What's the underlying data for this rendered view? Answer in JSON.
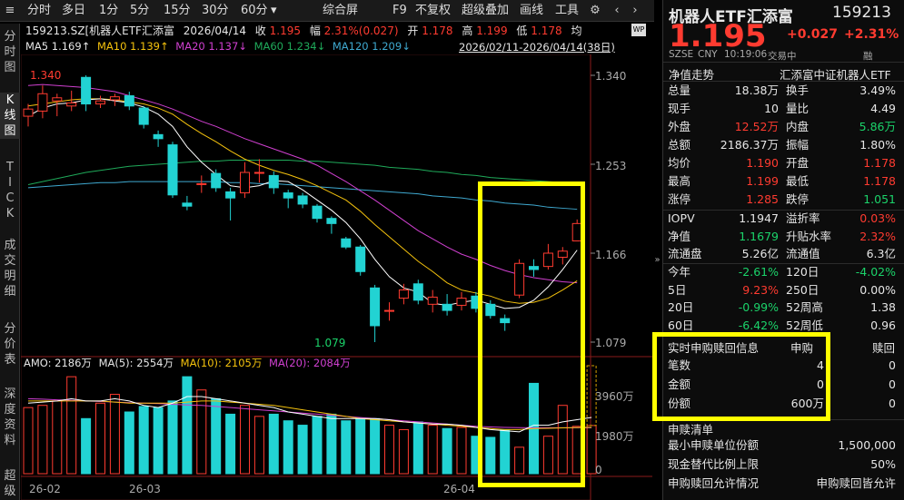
{
  "toolbar": {
    "items": [
      "分时",
      "多日",
      "1分",
      "5分",
      "15分",
      "30分",
      "60分"
    ],
    "more_label": "▾",
    "right_items": [
      "综合屏",
      "F9",
      "不复权",
      "超级叠加",
      "画线",
      "工具"
    ]
  },
  "leftnav": [
    {
      "label": "分\n时\n图",
      "active": false
    },
    {
      "label": "K\n线\n图",
      "active": true
    },
    {
      "label": "T\nI\nC\nK",
      "active": false
    },
    {
      "label": "成\n交\n明\n细",
      "active": false
    },
    {
      "label": "分\n价\n表",
      "active": false
    },
    {
      "label": "深\n度\n资\n料",
      "active": false
    },
    {
      "label": "超\n级",
      "active": false
    }
  ],
  "info_line": {
    "code_name": "159213.SZ[机器人ETF汇添富",
    "date": "2026/04/14",
    "close_label": "收",
    "close": "1.195",
    "chg_label": "幅",
    "chg": "2.31%(0.027)",
    "open_label": "开",
    "open": "1.178",
    "high_label": "高",
    "high": "1.199",
    "low_label": "低",
    "low": "1.178",
    "avg_label": "均"
  },
  "ma_line": {
    "ma5": "MA5 1.169↑",
    "ma10": "MA10 1.139↑",
    "ma20": "MA20 1.137↓",
    "ma60": "MA60 1.234↓",
    "ma120": "MA120 1.209↓",
    "range": "2026/02/11-2026/04/14(38日)"
  },
  "price_axis": [
    "1.340",
    "1.253",
    "1.166",
    "1.079"
  ],
  "vol_axis": [
    "3960万",
    "1980万",
    "0"
  ],
  "date_axis": [
    "26-02",
    "26-03",
    "26-04"
  ],
  "annotations": {
    "high_mark": "1.340",
    "low_mark": "1.079"
  },
  "volume_line": {
    "amo": "AMO: 2186万",
    "ma5": "MA(5): 2554万",
    "ma10": "MA(10): 2105万",
    "ma20": "MA(20): 2084万"
  },
  "colors": {
    "up": "#ff3b30",
    "down": "#22d3d3",
    "ma5": "#ffffff",
    "ma10": "#f4c20d",
    "ma20": "#d040d0",
    "ma60": "#1faa5a",
    "ma120": "#3fa9d0",
    "highlight_box": "#ffff00"
  },
  "chart_data": {
    "type": "candlestick",
    "ylim": [
      1.079,
      1.34
    ],
    "candles": [
      {
        "o": 1.3,
        "c": 1.307,
        "h": 1.312,
        "l": 1.29
      },
      {
        "o": 1.305,
        "c": 1.322,
        "h": 1.33,
        "l": 1.298
      },
      {
        "o": 1.315,
        "c": 1.318,
        "h": 1.322,
        "l": 1.3
      },
      {
        "o": 1.31,
        "c": 1.313,
        "h": 1.325,
        "l": 1.305
      },
      {
        "o": 1.338,
        "c": 1.312,
        "h": 1.34,
        "l": 1.305
      },
      {
        "o": 1.312,
        "c": 1.315,
        "h": 1.32,
        "l": 1.308
      },
      {
        "o": 1.316,
        "c": 1.319,
        "h": 1.322,
        "l": 1.31
      },
      {
        "o": 1.32,
        "c": 1.31,
        "h": 1.324,
        "l": 1.306
      },
      {
        "o": 1.308,
        "c": 1.292,
        "h": 1.31,
        "l": 1.288
      },
      {
        "o": 1.282,
        "c": 1.278,
        "h": 1.286,
        "l": 1.27
      },
      {
        "o": 1.272,
        "c": 1.223,
        "h": 1.275,
        "l": 1.22
      },
      {
        "o": 1.215,
        "c": 1.212,
        "h": 1.222,
        "l": 1.208
      },
      {
        "o": 1.234,
        "c": 1.234,
        "h": 1.242,
        "l": 1.225
      },
      {
        "o": 1.244,
        "c": 1.23,
        "h": 1.248,
        "l": 1.226
      },
      {
        "o": 1.226,
        "c": 1.22,
        "h": 1.23,
        "l": 1.198
      },
      {
        "o": 1.225,
        "c": 1.245,
        "h": 1.255,
        "l": 1.22
      },
      {
        "o": 1.245,
        "c": 1.245,
        "h": 1.258,
        "l": 1.235
      },
      {
        "o": 1.242,
        "c": 1.23,
        "h": 1.246,
        "l": 1.224
      },
      {
        "o": 1.225,
        "c": 1.22,
        "h": 1.228,
        "l": 1.21
      },
      {
        "o": 1.222,
        "c": 1.214,
        "h": 1.225,
        "l": 1.21
      },
      {
        "o": 1.212,
        "c": 1.2,
        "h": 1.214,
        "l": 1.196
      },
      {
        "o": 1.2,
        "c": 1.195,
        "h": 1.202,
        "l": 1.185
      },
      {
        "o": 1.18,
        "c": 1.172,
        "h": 1.182,
        "l": 1.17
      },
      {
        "o": 1.172,
        "c": 1.148,
        "h": 1.174,
        "l": 1.144
      },
      {
        "o": 1.132,
        "c": 1.095,
        "h": 1.135,
        "l": 1.079
      },
      {
        "o": 1.11,
        "c": 1.11,
        "h": 1.118,
        "l": 1.1
      },
      {
        "o": 1.122,
        "c": 1.13,
        "h": 1.136,
        "l": 1.116
      },
      {
        "o": 1.136,
        "c": 1.12,
        "h": 1.14,
        "l": 1.116
      },
      {
        "o": 1.116,
        "c": 1.123,
        "h": 1.13,
        "l": 1.108
      },
      {
        "o": 1.116,
        "c": 1.11,
        "h": 1.126,
        "l": 1.105
      },
      {
        "o": 1.115,
        "c": 1.122,
        "h": 1.128,
        "l": 1.11
      },
      {
        "o": 1.124,
        "c": 1.112,
        "h": 1.128,
        "l": 1.108
      },
      {
        "o": 1.116,
        "c": 1.105,
        "h": 1.12,
        "l": 1.102
      },
      {
        "o": 1.102,
        "c": 1.098,
        "h": 1.106,
        "l": 1.09
      },
      {
        "o": 1.125,
        "c": 1.156,
        "h": 1.16,
        "l": 1.122
      },
      {
        "o": 1.153,
        "c": 1.15,
        "h": 1.16,
        "l": 1.143
      },
      {
        "o": 1.153,
        "c": 1.166,
        "h": 1.175,
        "l": 1.15
      },
      {
        "o": 1.162,
        "c": 1.168,
        "h": 1.172,
        "l": 1.155
      },
      {
        "o": 1.178,
        "c": 1.195,
        "h": 1.199,
        "l": 1.178
      }
    ],
    "ma5": [
      1.3,
      1.308,
      1.312,
      1.313,
      1.316,
      1.317,
      1.315,
      1.313,
      1.309,
      1.302,
      1.29,
      1.27,
      1.255,
      1.243,
      1.232,
      1.23,
      1.232,
      1.237,
      1.236,
      1.228,
      1.218,
      1.208,
      1.196,
      1.18,
      1.16,
      1.143,
      1.132,
      1.128,
      1.117,
      1.115,
      1.118,
      1.12,
      1.116,
      1.112,
      1.113,
      1.12,
      1.133,
      1.15,
      1.169
    ],
    "ma10": [
      1.31,
      1.312,
      1.314,
      1.316,
      1.317,
      1.317,
      1.316,
      1.314,
      1.312,
      1.308,
      1.302,
      1.292,
      1.283,
      1.275,
      1.266,
      1.258,
      1.252,
      1.247,
      1.243,
      1.238,
      1.232,
      1.225,
      1.218,
      1.207,
      1.194,
      1.182,
      1.17,
      1.158,
      1.148,
      1.137,
      1.13,
      1.127,
      1.124,
      1.119,
      1.117,
      1.118,
      1.122,
      1.13,
      1.139
    ],
    "ma20": [
      1.33,
      1.331,
      1.33,
      1.329,
      1.328,
      1.326,
      1.324,
      1.32,
      1.316,
      1.312,
      1.307,
      1.301,
      1.295,
      1.29,
      1.284,
      1.278,
      1.273,
      1.268,
      1.263,
      1.258,
      1.252,
      1.244,
      1.236,
      1.227,
      1.218,
      1.208,
      1.198,
      1.188,
      1.18,
      1.172,
      1.165,
      1.16,
      1.154,
      1.149,
      1.145,
      1.142,
      1.14,
      1.138,
      1.137
    ],
    "ma60": [
      1.233,
      1.236,
      1.239,
      1.242,
      1.245,
      1.247,
      1.249,
      1.251,
      1.252,
      1.253,
      1.254,
      1.255,
      1.256,
      1.256,
      1.257,
      1.257,
      1.257,
      1.257,
      1.257,
      1.256,
      1.256,
      1.255,
      1.254,
      1.253,
      1.252,
      1.25,
      1.249,
      1.248,
      1.246,
      1.245,
      1.243,
      1.242,
      1.24,
      1.239,
      1.238,
      1.237,
      1.236,
      1.235,
      1.234
    ],
    "ma120": [
      1.23,
      1.231,
      1.232,
      1.233,
      1.234,
      1.235,
      1.235,
      1.236,
      1.236,
      1.236,
      1.236,
      1.236,
      1.236,
      1.236,
      1.235,
      1.235,
      1.234,
      1.234,
      1.233,
      1.232,
      1.231,
      1.23,
      1.229,
      1.228,
      1.227,
      1.226,
      1.225,
      1.224,
      1.222,
      1.221,
      1.22,
      1.218,
      1.217,
      1.215,
      1.214,
      1.213,
      1.211,
      1.21,
      1.209
    ],
    "volume_unit": "万",
    "volume_ylim": [
      0,
      4900
    ],
    "volumes": [
      3000,
      3100,
      3300,
      4400,
      2500,
      3200,
      3600,
      2800,
      3050,
      3000,
      3300,
      4400,
      3800,
      3400,
      2700,
      3100,
      2600,
      2700,
      2400,
      2200,
      2600,
      2700,
      2400,
      2500,
      2500,
      2200,
      2000,
      2350,
      2200,
      2050,
      2100,
      1700,
      1650,
      2000,
      1200,
      4100,
      1700,
      3100,
      2150,
      2186
    ],
    "volume_ma5": [
      3200,
      3250,
      3300,
      3400,
      3300,
      3300,
      3400,
      3300,
      3100,
      3000,
      3200,
      3500,
      3500,
      3400,
      3300,
      3200,
      3100,
      3000,
      2800,
      2700,
      2600,
      2500,
      2500,
      2500,
      2500,
      2450,
      2350,
      2300,
      2250,
      2250,
      2200,
      2100,
      2000,
      1950,
      1900,
      2200,
      2200,
      2350,
      2450,
      2554
    ],
    "volume_ma10": [
      3300,
      3300,
      3300,
      3300,
      3300,
      3300,
      3250,
      3200,
      3200,
      3200,
      3200,
      3250,
      3300,
      3300,
      3250,
      3200,
      3150,
      3100,
      3000,
      2900,
      2800,
      2700,
      2600,
      2500,
      2450,
      2400,
      2350,
      2300,
      2250,
      2200,
      2150,
      2100,
      2050,
      2000,
      2000,
      2050,
      2060,
      2080,
      2095,
      2105
    ],
    "volume_ma20": [
      3400,
      3380,
      3350,
      3330,
      3300,
      3280,
      3250,
      3220,
      3200,
      3180,
      3150,
      3120,
      3100,
      3050,
      3000,
      2950,
      2900,
      2850,
      2800,
      2750,
      2700,
      2650,
      2600,
      2550,
      2500,
      2450,
      2400,
      2350,
      2300,
      2250,
      2200,
      2150,
      2120,
      2100,
      2090,
      2085,
      2085,
      2084,
      2084,
      2084
    ]
  },
  "quote": {
    "name": "机器人ETF汇添富",
    "code": "159213",
    "price": "1.195",
    "change": "+0.027",
    "change_pct": "+2.31%",
    "exchange": "SZSE",
    "currency": "CNY",
    "time": "10:19:06",
    "status": "交易中",
    "rong": "融",
    "nav_trend_label": "净值走势",
    "fund_full_name": "汇添富中证机器人ETF"
  },
  "quote_rows": [
    [
      {
        "k": "总量",
        "v": "18.38万",
        "c": "white"
      },
      {
        "k": "换手",
        "v": "3.49%",
        "c": "white"
      }
    ],
    [
      {
        "k": "现手",
        "v": "10",
        "c": "white"
      },
      {
        "k": "量比",
        "v": "4.49",
        "c": "white"
      }
    ],
    [
      {
        "k": "外盘",
        "v": "12.52万",
        "c": "red"
      },
      {
        "k": "内盘",
        "v": "5.86万",
        "c": "green"
      }
    ],
    [
      {
        "k": "总额",
        "v": "2186.37万",
        "c": "white"
      },
      {
        "k": "振幅",
        "v": "1.80%",
        "c": "white"
      }
    ],
    [
      {
        "k": "均价",
        "v": "1.190",
        "c": "red"
      },
      {
        "k": "开盘",
        "v": "1.178",
        "c": "red"
      }
    ],
    [
      {
        "k": "最高",
        "v": "1.199",
        "c": "red"
      },
      {
        "k": "最低",
        "v": "1.178",
        "c": "red"
      }
    ],
    [
      {
        "k": "涨停",
        "v": "1.285",
        "c": "red"
      },
      {
        "k": "跌停",
        "v": "1.051",
        "c": "green"
      }
    ]
  ],
  "nav_rows": [
    [
      {
        "k": "IOPV",
        "v": "1.1947",
        "c": "white"
      },
      {
        "k": "溢折率",
        "v": "0.03%",
        "c": "red"
      }
    ],
    [
      {
        "k": "净值",
        "v": "1.1679",
        "c": "green"
      },
      {
        "k": "升贴水率",
        "v": "2.32%",
        "c": "red"
      }
    ],
    [
      {
        "k": "流通盘",
        "v": "5.26亿",
        "c": "white"
      },
      {
        "k": "流通值",
        "v": "6.3亿",
        "c": "white"
      }
    ]
  ],
  "perf_rows": [
    [
      {
        "k": "今年",
        "v": "-2.61%",
        "c": "green"
      },
      {
        "k": "120日",
        "v": "-4.02%",
        "c": "green"
      }
    ],
    [
      {
        "k": "5日",
        "v": "9.23%",
        "c": "red"
      },
      {
        "k": "250日",
        "v": "0.00%",
        "c": "white"
      }
    ],
    [
      {
        "k": "20日",
        "v": "-0.99%",
        "c": "green"
      },
      {
        "k": "52周高",
        "v": "1.38",
        "c": "white"
      }
    ],
    [
      {
        "k": "60日",
        "v": "-6.42%",
        "c": "green"
      },
      {
        "k": "52周低",
        "v": "0.96",
        "c": "white"
      }
    ]
  ],
  "subscription": {
    "title": "实时申购赎回信息",
    "col_sub": "申购",
    "col_red": "赎回",
    "rows": [
      {
        "k": "笔数",
        "sub": "4",
        "red": "0"
      },
      {
        "k": "金额",
        "sub": "0",
        "red": "0"
      },
      {
        "k": "份额",
        "sub": "600万",
        "red": "0"
      }
    ]
  },
  "redemption_list": {
    "title": "申赎清单",
    "rows": [
      {
        "k": "最小申赎单位份额",
        "v": "1,500,000"
      },
      {
        "k": "现金替代比例上限",
        "v": "50%"
      },
      {
        "k": "申购赎回允许情况",
        "v": "申购赎回皆允许"
      }
    ]
  }
}
